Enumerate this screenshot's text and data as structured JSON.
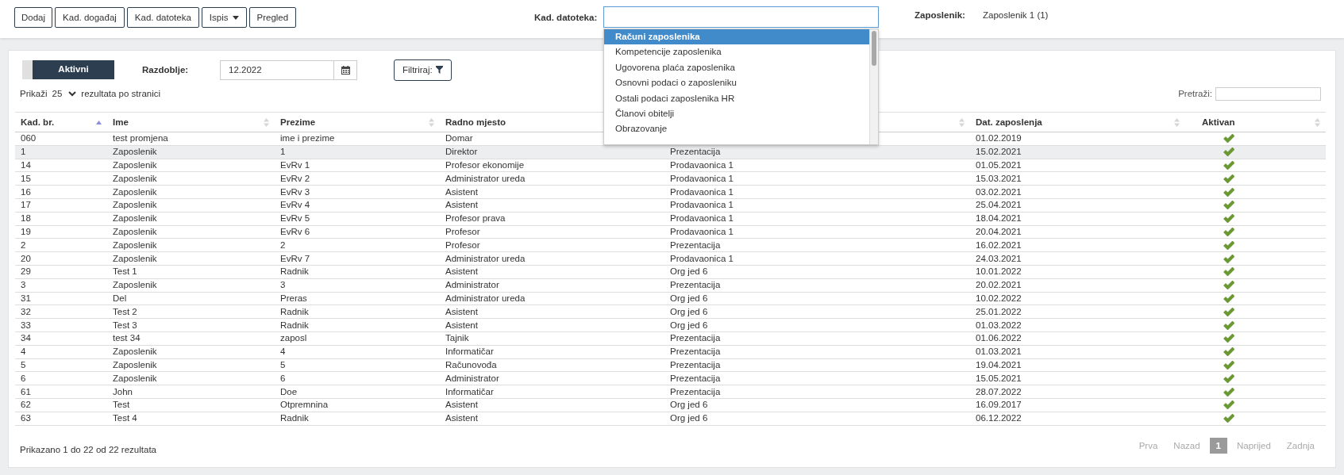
{
  "toolbar": {
    "buttons": [
      {
        "label": "Dodaj",
        "kind": "plain"
      },
      {
        "label": "Kad. događaj",
        "kind": "plain"
      },
      {
        "label": "Kad. datoteka",
        "kind": "plain"
      },
      {
        "label": "Ispis",
        "kind": "dropdown"
      },
      {
        "label": "Pregled",
        "kind": "plain"
      }
    ]
  },
  "file_field": {
    "label": "Kad. datoteka:",
    "expanded": true,
    "options": [
      {
        "label": "Računi zaposlenika",
        "selected": true
      },
      {
        "label": "Kompetencije zaposlenika",
        "selected": false
      },
      {
        "label": "Ugovorena plaća zaposlenika",
        "selected": false
      },
      {
        "label": "Osnovni podaci o zaposleniku",
        "selected": false
      },
      {
        "label": "Ostali podaci zaposlenika HR",
        "selected": false
      },
      {
        "label": "Članovi obitelji",
        "selected": false
      },
      {
        "label": "Obrazovanje",
        "selected": false
      }
    ]
  },
  "employee": {
    "label": "Zaposlenik:",
    "value": "Zaposlenik 1 (1)"
  },
  "filters": {
    "toggle": {
      "label": "Aktivni",
      "on": true
    },
    "period": {
      "label": "Razdoblje:",
      "value": "12.2022"
    },
    "filter_button": "Filtriraj:"
  },
  "page_size": {
    "prefix": "Prikaži",
    "value": "25",
    "suffix": "rezultata po stranici"
  },
  "search": {
    "label": "Pretraži:"
  },
  "table": {
    "columns": [
      {
        "label": "Kad. br.",
        "sorted": true
      },
      {
        "label": "Ime",
        "sorted": false
      },
      {
        "label": "Prezime",
        "sorted": false
      },
      {
        "label": "Radno mjesto"
      },
      {
        "sorted": false
      },
      {
        "label": "Dat. zaposlenja",
        "sorted": false
      },
      {
        "label": "Aktivan",
        "sorted": false
      }
    ],
    "rows": [
      {
        "kad_br": "060",
        "ime": "test promjena",
        "prezime": "ime i prezime",
        "radno_mjesto": "Domar",
        "dat_zaposlenja": "01.02.2019",
        "aktivan": true,
        "selected": false
      },
      {
        "kad_br": "1",
        "ime": "Zaposlenik",
        "prezime": "1",
        "radno_mjesto": "Direktor",
        "column_5": "Prezentacija",
        "dat_zaposlenja": "15.02.2021",
        "aktivan": true,
        "selected": true
      },
      {
        "kad_br": "14",
        "ime": "Zaposlenik",
        "prezime": "EvRv 1",
        "radno_mjesto": "Profesor ekonomije",
        "column_5": "Prodavaonica 1",
        "dat_zaposlenja": "01.05.2021",
        "aktivan": true,
        "selected": false
      },
      {
        "kad_br": "15",
        "ime": "Zaposlenik",
        "prezime": "EvRv 2",
        "radno_mjesto": "Administrator ureda",
        "column_5": "Prodavaonica 1",
        "dat_zaposlenja": "15.03.2021",
        "aktivan": true,
        "selected": false
      },
      {
        "kad_br": "16",
        "ime": "Zaposlenik",
        "prezime": "EvRv 3",
        "radno_mjesto": "Asistent",
        "column_5": "Prodavaonica 1",
        "dat_zaposlenja": "03.02.2021",
        "aktivan": true,
        "selected": false
      },
      {
        "kad_br": "17",
        "ime": "Zaposlenik",
        "prezime": "EvRv 4",
        "radno_mjesto": "Asistent",
        "column_5": "Prodavaonica 1",
        "dat_zaposlenja": "25.04.2021",
        "aktivan": true,
        "selected": false
      },
      {
        "kad_br": "18",
        "ime": "Zaposlenik",
        "prezime": "EvRv 5",
        "radno_mjesto": "Profesor prava",
        "column_5": "Prodavaonica 1",
        "dat_zaposlenja": "18.04.2021",
        "aktivan": true,
        "selected": false
      },
      {
        "kad_br": "19",
        "ime": "Zaposlenik",
        "prezime": "EvRv 6",
        "radno_mjesto": "Profesor",
        "column_5": "Prodavaonica 1",
        "dat_zaposlenja": "20.04.2021",
        "aktivan": true,
        "selected": false
      },
      {
        "kad_br": "2",
        "ime": "Zaposlenik",
        "prezime": "2",
        "radno_mjesto": "Profesor",
        "column_5": "Prezentacija",
        "dat_zaposlenja": "16.02.2021",
        "aktivan": true,
        "selected": false
      },
      {
        "kad_br": "20",
        "ime": "Zaposlenik",
        "prezime": "EvRv 7",
        "radno_mjesto": "Administrator ureda",
        "column_5": "Prodavaonica 1",
        "dat_zaposlenja": "24.03.2021",
        "aktivan": true,
        "selected": false
      },
      {
        "kad_br": "29",
        "ime": "Test 1",
        "prezime": "Radnik",
        "radno_mjesto": "Asistent",
        "column_5": "Org jed 6",
        "dat_zaposlenja": "10.01.2022",
        "aktivan": true,
        "selected": false
      },
      {
        "kad_br": "3",
        "ime": "Zaposlenik",
        "prezime": "3",
        "radno_mjesto": "Administrator",
        "column_5": "Prezentacija",
        "dat_zaposlenja": "20.02.2021",
        "aktivan": true,
        "selected": false
      },
      {
        "kad_br": "31",
        "ime": "Del",
        "prezime": "Preras",
        "radno_mjesto": "Administrator ureda",
        "column_5": "Org jed 6",
        "dat_zaposlenja": "10.02.2022",
        "aktivan": true,
        "selected": false
      },
      {
        "kad_br": "32",
        "ime": "Test 2",
        "prezime": "Radnik",
        "radno_mjesto": "Asistent",
        "column_5": "Org jed 6",
        "dat_zaposlenja": "25.01.2022",
        "aktivan": true,
        "selected": false
      },
      {
        "kad_br": "33",
        "ime": "Test 3",
        "prezime": "Radnik",
        "radno_mjesto": "Asistent",
        "column_5": "Org jed 6",
        "dat_zaposlenja": "01.03.2022",
        "aktivan": true,
        "selected": false
      },
      {
        "kad_br": "34",
        "ime": "test 34",
        "prezime": "zaposl",
        "radno_mjesto": "Tajnik",
        "column_5": "Prezentacija",
        "dat_zaposlenja": "01.06.2022",
        "aktivan": true,
        "selected": false
      },
      {
        "kad_br": "4",
        "ime": "Zaposlenik",
        "prezime": "4",
        "radno_mjesto": "Informatičar",
        "column_5": "Prezentacija",
        "dat_zaposlenja": "01.03.2021",
        "aktivan": true,
        "selected": false
      },
      {
        "kad_br": "5",
        "ime": "Zaposlenik",
        "prezime": "5",
        "radno_mjesto": "Računovođa",
        "column_5": "Prezentacija",
        "dat_zaposlenja": "19.04.2021",
        "aktivan": true,
        "selected": false
      },
      {
        "kad_br": "6",
        "ime": "Zaposlenik",
        "prezime": "6",
        "radno_mjesto": "Administrator",
        "column_5": "Prezentacija",
        "dat_zaposlenja": "15.05.2021",
        "aktivan": true,
        "selected": false
      },
      {
        "kad_br": "61",
        "ime": "John",
        "prezime": "Doe",
        "radno_mjesto": "Informatičar",
        "column_5": "Prezentacija",
        "dat_zaposlenja": "28.07.2022",
        "aktivan": true,
        "selected": false
      },
      {
        "kad_br": "62",
        "ime": "Test",
        "prezime": "Otpremnina",
        "radno_mjesto": "Asistent",
        "column_5": "Org jed 6",
        "dat_zaposlenja": "16.09.2017",
        "aktivan": true,
        "selected": false
      },
      {
        "kad_br": "63",
        "ime": "Test 4",
        "prezime": "Radnik",
        "radno_mjesto": "Asistent",
        "column_5": "Org jed 6",
        "dat_zaposlenja": "06.12.2022",
        "aktivan": true,
        "selected": false
      }
    ]
  },
  "summary": "Prikazano 1 do 22 od 22 rezultata",
  "pagination": [
    {
      "label": "Prva",
      "disabled": true,
      "selected": false
    },
    {
      "label": "Nazad",
      "disabled": true,
      "selected": false
    },
    {
      "label": "1",
      "disabled": false,
      "selected": true
    },
    {
      "label": "Naprijed",
      "disabled": true,
      "selected": false
    },
    {
      "label": "Zadnja",
      "disabled": true,
      "selected": false
    }
  ]
}
